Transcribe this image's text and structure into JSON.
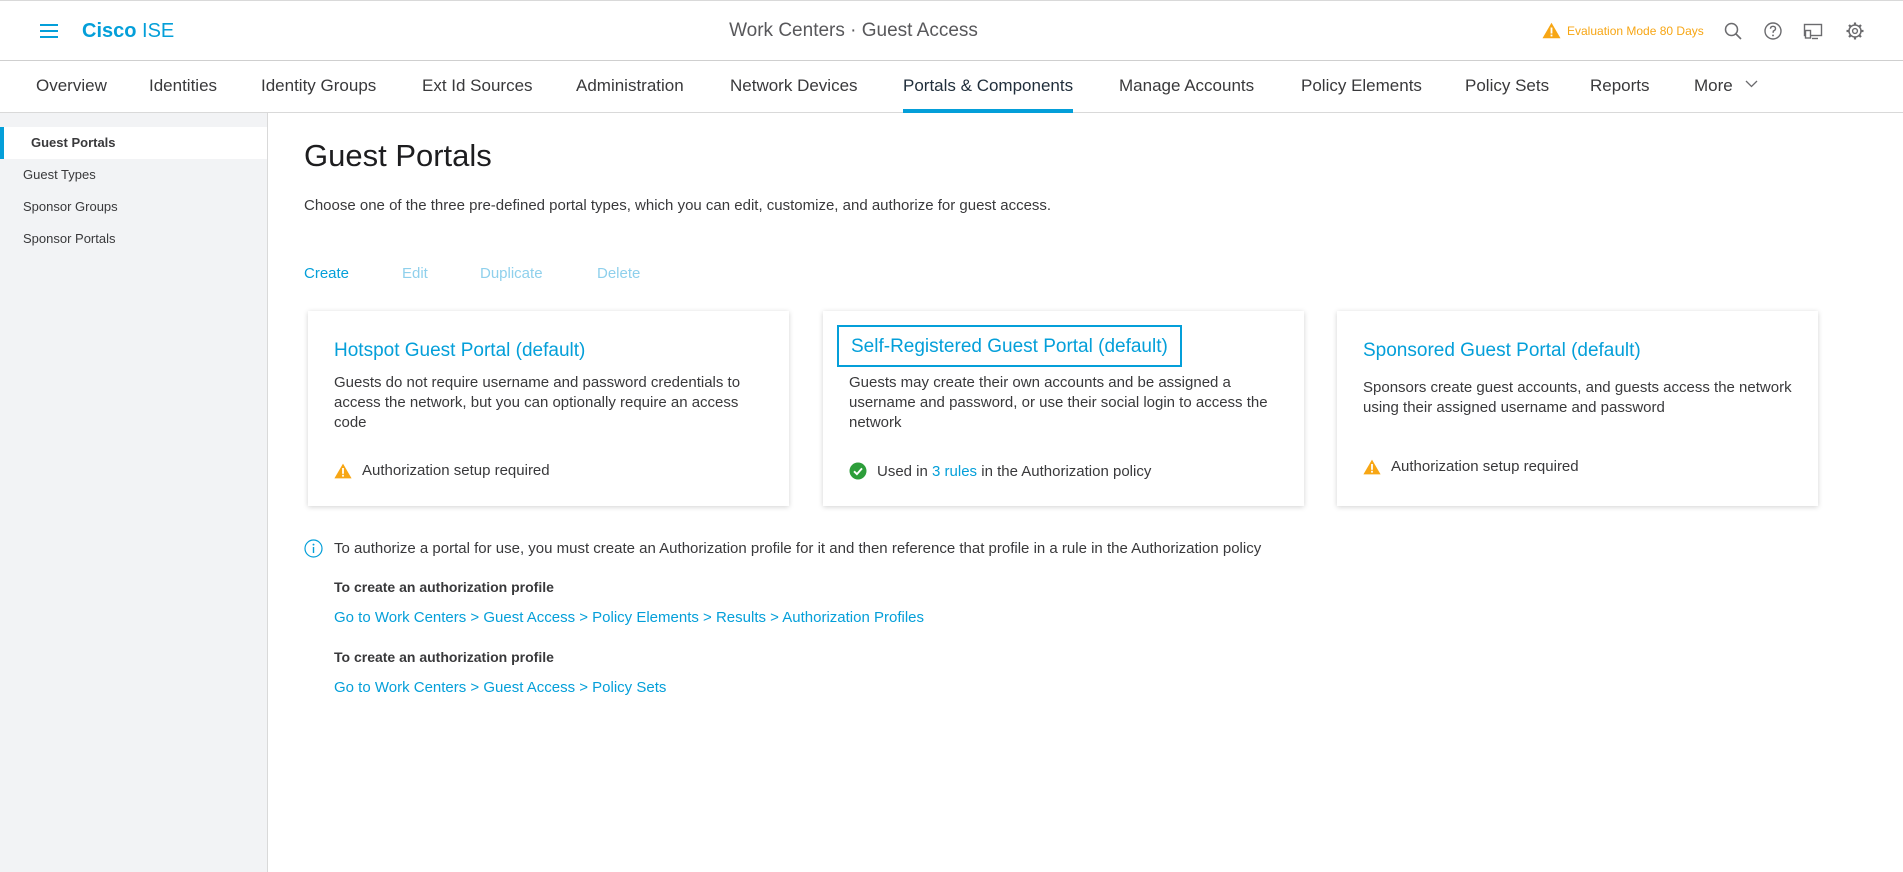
{
  "header": {
    "brand_bold": "Cisco",
    "brand_light": "ISE",
    "title": "Work Centers · Guest Access",
    "evaluation": "Evaluation Mode 80 Days",
    "icons": [
      "menu-icon",
      "warning-icon",
      "search-icon",
      "help-icon",
      "notifications-icon",
      "settings-icon"
    ]
  },
  "tabs": [
    {
      "label": "Overview"
    },
    {
      "label": "Identities"
    },
    {
      "label": "Identity Groups"
    },
    {
      "label": "Ext Id Sources"
    },
    {
      "label": "Administration"
    },
    {
      "label": "Network Devices"
    },
    {
      "label": "Portals & Components",
      "active": true
    },
    {
      "label": "Manage Accounts"
    },
    {
      "label": "Policy Elements"
    },
    {
      "label": "Policy Sets"
    },
    {
      "label": "Reports"
    },
    {
      "label": "More"
    }
  ],
  "sidebar": {
    "items": [
      {
        "label": "Guest Portals",
        "active": true
      },
      {
        "label": "Guest Types"
      },
      {
        "label": "Sponsor Groups"
      },
      {
        "label": "Sponsor Portals"
      }
    ]
  },
  "page": {
    "title": "Guest Portals",
    "description": "Choose one of the three pre-defined portal types, which you can edit, customize, and authorize for guest access."
  },
  "actions": {
    "create": "Create",
    "edit": "Edit",
    "duplicate": "Duplicate",
    "delete": "Delete"
  },
  "cards": [
    {
      "title": "Hotspot Guest Portal (default)",
      "description": "Guests do not require username and password credentials to access the network, but you can optionally require an access code",
      "status": "Authorization setup required"
    },
    {
      "title": "Self-Registered Guest Portal (default)",
      "description": "Guests may create their own accounts and be assigned a username and password, or use their social login to access the network",
      "status_prefix": "Used in",
      "status_link": "3 rules",
      "status_suffix": "in the Authorization policy"
    },
    {
      "title": "Sponsored Guest Portal (default)",
      "description": "Sponsors create guest accounts, and guests access the network using their assigned username and password",
      "status": "Authorization setup required"
    }
  ],
  "info": {
    "text": "To authorize a portal for use, you must create an Authorization profile for it and then reference that profile in a rule in the Authorization policy",
    "sections": [
      {
        "heading": "To create an authorization profile",
        "link": "Go to Work Centers > Guest Access > Policy Elements > Results > Authorization Profiles"
      },
      {
        "heading": "To create an authorization profile",
        "link": "Go to Work Centers > Guest Access > Policy Sets"
      }
    ]
  },
  "colors": {
    "accent": "#049fd9",
    "warning": "#f7a614",
    "success": "#2d9e3a",
    "disabled_link": "#8fd0ec"
  }
}
